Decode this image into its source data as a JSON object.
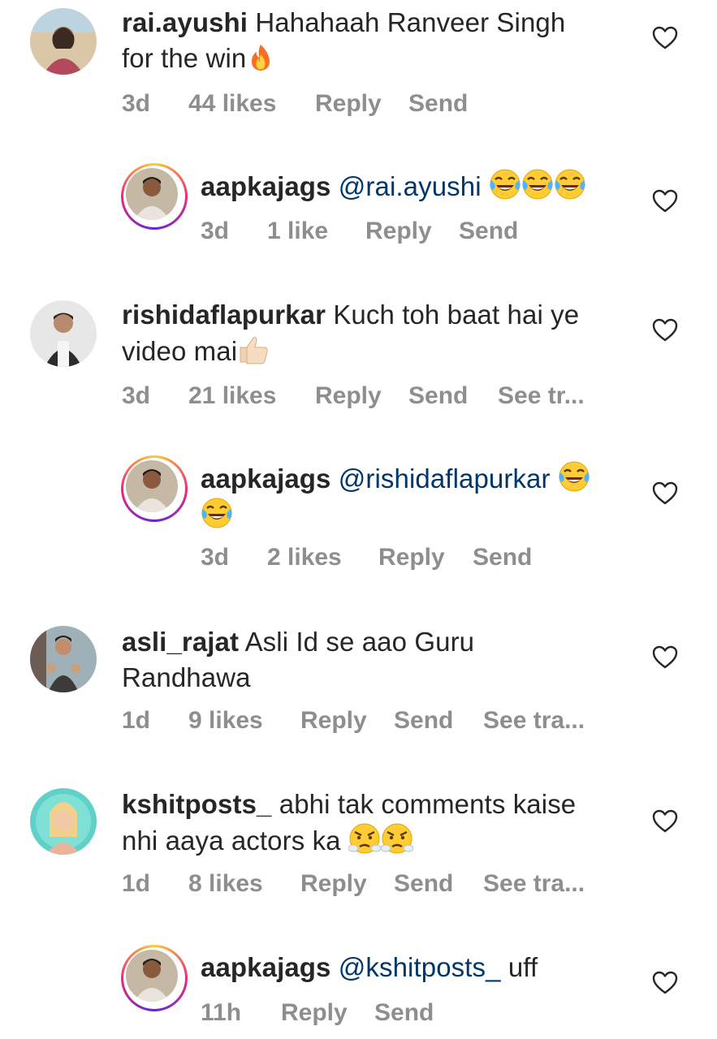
{
  "comments": [
    {
      "username": "rai.ayushi",
      "text": "Hahahaah Ranveer Singh",
      "text2": "for the win",
      "emoji": "fire",
      "time": "3d",
      "likes": "44 likes",
      "reply": "Reply",
      "send": "Send"
    },
    {
      "username": "aapkajags",
      "mention": "@rai.ayushi",
      "emoji": "tears-of-joy",
      "time": "3d",
      "likes": "1 like",
      "reply": "Reply",
      "send": "Send"
    },
    {
      "username": "rishidaflapurkar",
      "text": "Kuch toh baat hai ye",
      "text2": "video mai",
      "emoji": "thumbs-up",
      "time": "3d",
      "likes": "21 likes",
      "reply": "Reply",
      "send": "Send",
      "see_translation": "See tr..."
    },
    {
      "username": "aapkajags",
      "mention": "@rishidaflapurkar",
      "emoji": "tears-of-joy",
      "time": "3d",
      "likes": "2 likes",
      "reply": "Reply",
      "send": "Send"
    },
    {
      "username": "asli_rajat",
      "text": "Asli Id se aao Guru",
      "text2": "Randhawa",
      "time": "1d",
      "likes": "9 likes",
      "reply": "Reply",
      "send": "Send",
      "see_translation": "See tra..."
    },
    {
      "username": "kshitposts_",
      "text": "abhi tak comments kaise",
      "text2": "nhi aaya actors ka",
      "emoji": "steam-from-nose",
      "time": "1d",
      "likes": "8 likes",
      "reply": "Reply",
      "send": "Send",
      "see_translation": "See tra..."
    },
    {
      "username": "aapkajags",
      "mention": "@kshitposts_",
      "text": "uff",
      "time": "11h",
      "reply": "Reply",
      "send": "Send"
    }
  ],
  "colors": {
    "text": "#262626",
    "meta": "#8e8e8e",
    "mention": "#00376b",
    "story_ring": [
      "#f9ce34",
      "#ee2a7b",
      "#6228d7"
    ]
  },
  "icons": [
    "heart-outline-icon",
    "fire-emoji",
    "tears-of-joy-emoji",
    "thumbs-up-emoji",
    "steam-from-nose-emoji"
  ]
}
